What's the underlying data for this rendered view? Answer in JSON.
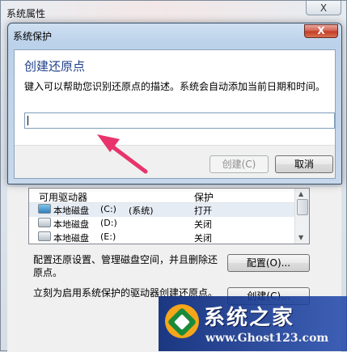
{
  "background_window": {
    "title": "系统属性",
    "close_label": "X",
    "drive_list": {
      "headers": [
        "可用驱动器",
        "保护"
      ],
      "rows": [
        {
          "name": "本地磁盘",
          "drive": "(C:)",
          "tag": "(系统)",
          "protection": "打开"
        },
        {
          "name": "本地磁盘",
          "drive": "(D:)",
          "tag": "",
          "protection": "关闭"
        },
        {
          "name": "本地磁盘",
          "drive": "(E:)",
          "tag": "",
          "protection": "关闭"
        }
      ]
    },
    "configure_text_line1": "配置还原设置、管理磁盘空间，并且删除还",
    "configure_text_line2": "原点。",
    "configure_button": "配置(O)...",
    "create_text": "立刻为启用系统保护的驱动器创建还原点。",
    "create_button": "创建(C)..."
  },
  "dialog": {
    "title": "系统保护",
    "close_label": "X",
    "heading": "创建还原点",
    "description": "键入可以帮助您识别还原点的描述。系统会自动添加当前日期和时间。",
    "input_value": "",
    "create_button": "创建(C)",
    "cancel_button": "取消"
  },
  "annotation": {
    "arrow_color": "#e8336b"
  },
  "watermark": {
    "name": "系统之家",
    "url": "www.Ghost123.com"
  }
}
